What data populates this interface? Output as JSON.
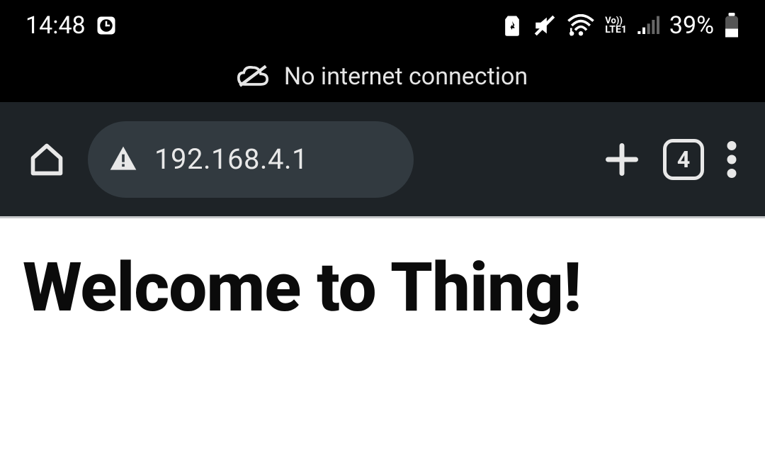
{
  "status": {
    "time": "14:48",
    "battery_percent": "39%",
    "lte_top": "Vo))",
    "lte_bottom": "LTE1"
  },
  "notification": {
    "message": "No internet connection"
  },
  "browser": {
    "address": "192.168.4.1",
    "tab_count": "4"
  },
  "page": {
    "heading": "Welcome to Thing!"
  }
}
